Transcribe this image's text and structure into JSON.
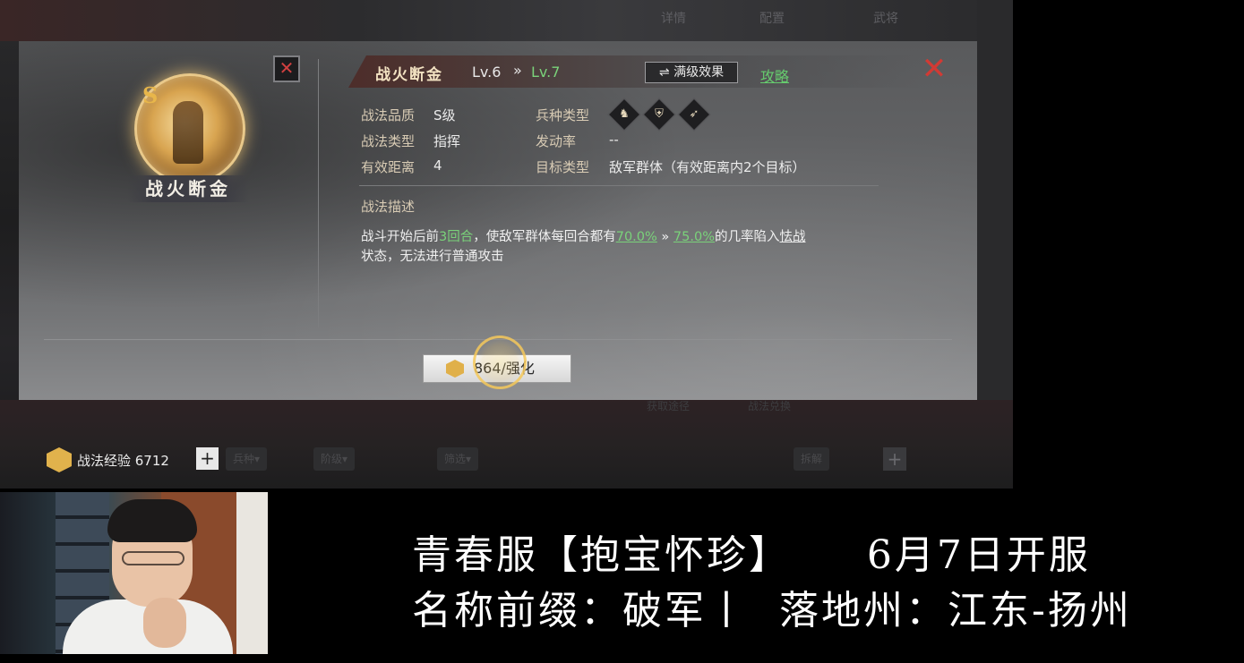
{
  "header": {
    "tabs": [
      "详情",
      "配置",
      "武将"
    ]
  },
  "skill_panel": {
    "portrait_name": "战火断金",
    "grade_mark": "S",
    "title": "战火断金",
    "level_current": "Lv.6",
    "level_arrow": "»",
    "level_next": "Lv.7",
    "max_level_button": "⇌ 满级效果",
    "guide_link": "攻略",
    "close_small": "✕",
    "close_big": "✕",
    "attributes": {
      "quality_label": "战法品质",
      "quality_value": "S级",
      "type_label": "战法类型",
      "type_value": "指挥",
      "range_label": "有效距离",
      "range_value": "4",
      "troop_label": "兵种类型",
      "trigger_label": "发动率",
      "trigger_value": "--",
      "target_label": "目标类型",
      "target_value": "敌军群体（有效距离内2个目标）"
    },
    "troop_icons": [
      "cavalry-icon",
      "shield-icon",
      "bow-icon"
    ],
    "description": {
      "title": "战法描述",
      "part1": "战斗开始后前",
      "rounds": "3回合",
      "part2": "，使敌军群体每回合都有",
      "rate_current": "70.0%",
      "arrow": " » ",
      "rate_next": "75.0%",
      "part3": "的几率陷入",
      "status": "怯战",
      "part4": "状态，无法进行普通攻击"
    },
    "upgrade_button": "864/强化"
  },
  "bottom_bar": {
    "exp_label": "战法经验 6712",
    "plus": "+",
    "faded_row": [
      "获取途径",
      "战法兑换"
    ],
    "faded_buttons": [
      "兵种▾",
      "阶级▾",
      "筛选▾",
      "拆解"
    ]
  },
  "announcement": {
    "line1": "青春服【抱宝怀珍】     6月7日开服",
    "line2": "名称前缀：破军丨  落地州：江东-扬州"
  },
  "colors": {
    "accent_green": "#7ad27a",
    "close_red": "#d23a34",
    "label_gold": "#d8cbb4"
  }
}
